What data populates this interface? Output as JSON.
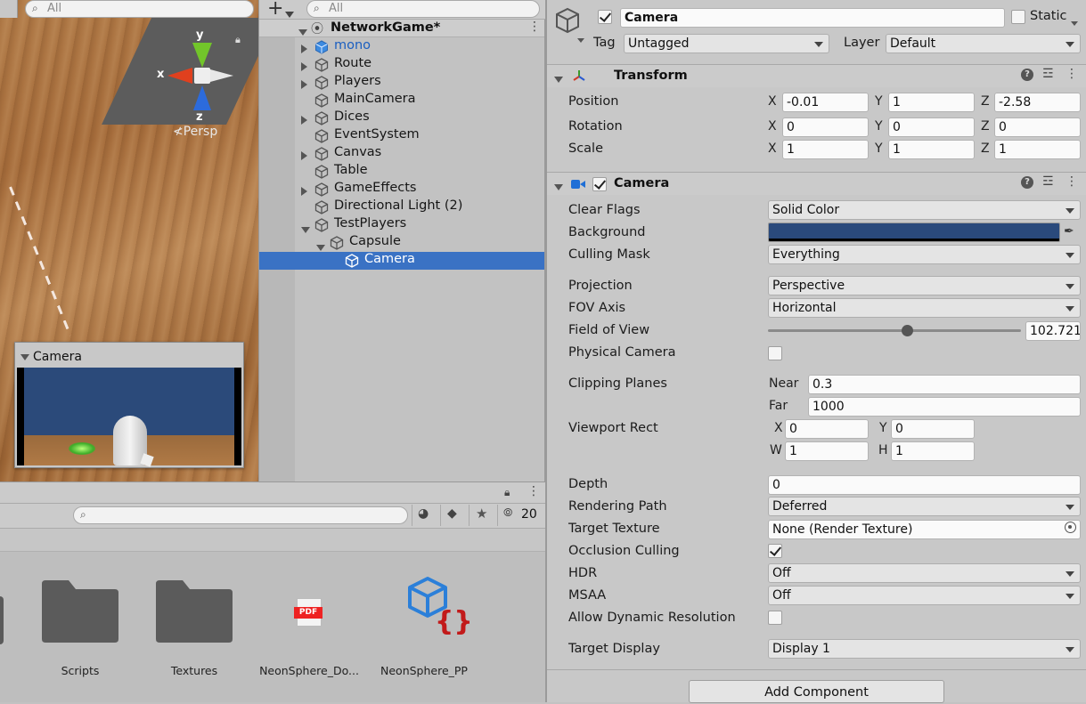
{
  "scene": {
    "search_placeholder": "All",
    "gizmo": {
      "y": "y",
      "x": "x",
      "z": "z",
      "persp": "≮Persp"
    },
    "camera_preview_title": "Camera"
  },
  "hierarchy": {
    "search_placeholder": "All",
    "add_label": "+",
    "scene_name": "NetworkGame*",
    "items": [
      {
        "label": "mono",
        "depth": 1,
        "arrow": "right",
        "blue": true
      },
      {
        "label": "Route",
        "depth": 1,
        "arrow": "right"
      },
      {
        "label": "Players",
        "depth": 1,
        "arrow": "right"
      },
      {
        "label": "MainCamera",
        "depth": 1,
        "arrow": "none"
      },
      {
        "label": "Dices",
        "depth": 1,
        "arrow": "right"
      },
      {
        "label": "EventSystem",
        "depth": 1,
        "arrow": "none"
      },
      {
        "label": "Canvas",
        "depth": 1,
        "arrow": "right"
      },
      {
        "label": "Table",
        "depth": 1,
        "arrow": "none"
      },
      {
        "label": "GameEffects",
        "depth": 1,
        "arrow": "right"
      },
      {
        "label": "Directional Light (2)",
        "depth": 1,
        "arrow": "none"
      },
      {
        "label": "TestPlayers",
        "depth": 1,
        "arrow": "down"
      },
      {
        "label": "Capsule",
        "depth": 2,
        "arrow": "down"
      },
      {
        "label": "Camera",
        "depth": 3,
        "arrow": "none",
        "selected": true
      }
    ]
  },
  "project": {
    "hidden_count": "20",
    "items": [
      {
        "label": "Scripts",
        "kind": "folder"
      },
      {
        "label": "Textures",
        "kind": "folder"
      },
      {
        "label": "NeonSphere_Do...",
        "kind": "pdf",
        "badge": "PDF"
      },
      {
        "label": "NeonSphere_PP",
        "kind": "prefab"
      }
    ]
  },
  "inspector": {
    "object_name": "Camera",
    "static_label": "Static",
    "tag_label": "Tag",
    "tag_value": "Untagged",
    "layer_label": "Layer",
    "layer_value": "Default",
    "transform": {
      "title": "Transform",
      "position_label": "Position",
      "rotation_label": "Rotation",
      "scale_label": "Scale",
      "position": {
        "x": "-0.01",
        "y": "1",
        "z": "-2.58"
      },
      "rotation": {
        "x": "0",
        "y": "0",
        "z": "0"
      },
      "scale": {
        "x": "1",
        "y": "1",
        "z": "1"
      }
    },
    "camera": {
      "title": "Camera",
      "clear_flags_label": "Clear Flags",
      "clear_flags": "Solid Color",
      "background_label": "Background",
      "background_color": "#2a4a7c",
      "culling_mask_label": "Culling Mask",
      "culling_mask": "Everything",
      "projection_label": "Projection",
      "projection": "Perspective",
      "fov_axis_label": "FOV Axis",
      "fov_axis": "Horizontal",
      "fov_label": "Field of View",
      "fov_value": "102.721",
      "fov_fraction": 0.55,
      "physical_label": "Physical Camera",
      "clipping_label": "Clipping Planes",
      "near_label": "Near",
      "near": "0.3",
      "far_label": "Far",
      "far": "1000",
      "viewport_label": "Viewport Rect",
      "vp": {
        "x": "0",
        "y": "0",
        "w": "1",
        "h": "1"
      },
      "depth_label": "Depth",
      "depth": "0",
      "rendering_path_label": "Rendering Path",
      "rendering_path": "Deferred",
      "target_texture_label": "Target Texture",
      "target_texture": "None (Render Texture)",
      "occlusion_label": "Occlusion Culling",
      "hdr_label": "HDR",
      "hdr": "Off",
      "msaa_label": "MSAA",
      "msaa": "Off",
      "dynres_label": "Allow Dynamic Resolution",
      "target_display_label": "Target Display",
      "target_display": "Display 1"
    },
    "add_component": "Add Component",
    "axis": {
      "x": "X",
      "y": "Y",
      "z": "Z",
      "w": "W",
      "h": "H"
    }
  }
}
